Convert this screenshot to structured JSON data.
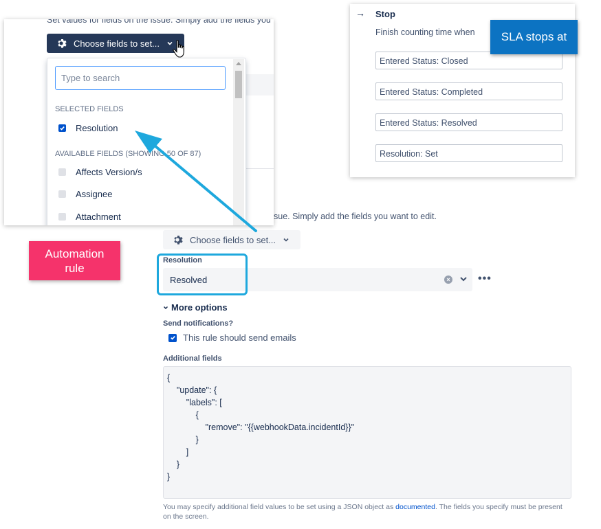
{
  "edit_panel": {
    "intro_text": "sue. Simply add the fields you want to edit.",
    "choose_fields_label": "Choose fields to set...",
    "resolution_label": "Resolution",
    "resolution_value": "Resolved",
    "clear_symbol": "×",
    "more_actions": "•••",
    "more_options_label": "More options",
    "send_notifications_label": "Send notifications?",
    "send_emails_label": "This rule should send emails",
    "send_emails_checked": true,
    "additional_fields_label": "Additional fields",
    "code_lines": [
      "{",
      "    \"update\": {",
      "        \"labels\": [",
      "            {",
      "                \"remove\": \"{{webhookData.incidentId}}\"",
      "            }",
      "        ]",
      "    }",
      "}"
    ],
    "help_text_before": "You may specify additional field values to be set using a JSON object as ",
    "help_link": "documented",
    "help_text_after": ". The fields you specify must be present on the screen."
  },
  "field_picker": {
    "intro_text": "Set values for fields on the issue. Simply add the fields you",
    "button_label": "Choose fields to set...",
    "search_placeholder": "Type to search",
    "selected_heading": "SELECTED FIELDS",
    "selected_items": [
      {
        "label": "Resolution",
        "checked": true
      }
    ],
    "available_heading": "AVAILABLE FIELDS (SHOWING 50 OF 87)",
    "available_items": [
      {
        "label": "Affects Version/s",
        "checked": false
      },
      {
        "label": "Assignee",
        "checked": false
      },
      {
        "label": "Attachment",
        "checked": false
      }
    ]
  },
  "sla_stop": {
    "title": "Stop",
    "subtitle": "Finish counting time when",
    "conditions": [
      "Entered Status: Closed",
      "Entered Status: Completed",
      "Entered Status: Resolved",
      "Resolution: Set"
    ]
  },
  "callouts": {
    "sla": "SLA stops at",
    "automation": "Automation rule"
  },
  "colors": {
    "callout_blue": "#0c73c2",
    "callout_pink": "#f5336b",
    "arrow_cyan": "#1ea8dd",
    "button_dark": "#253858",
    "checkbox_blue": "#0052cc"
  }
}
